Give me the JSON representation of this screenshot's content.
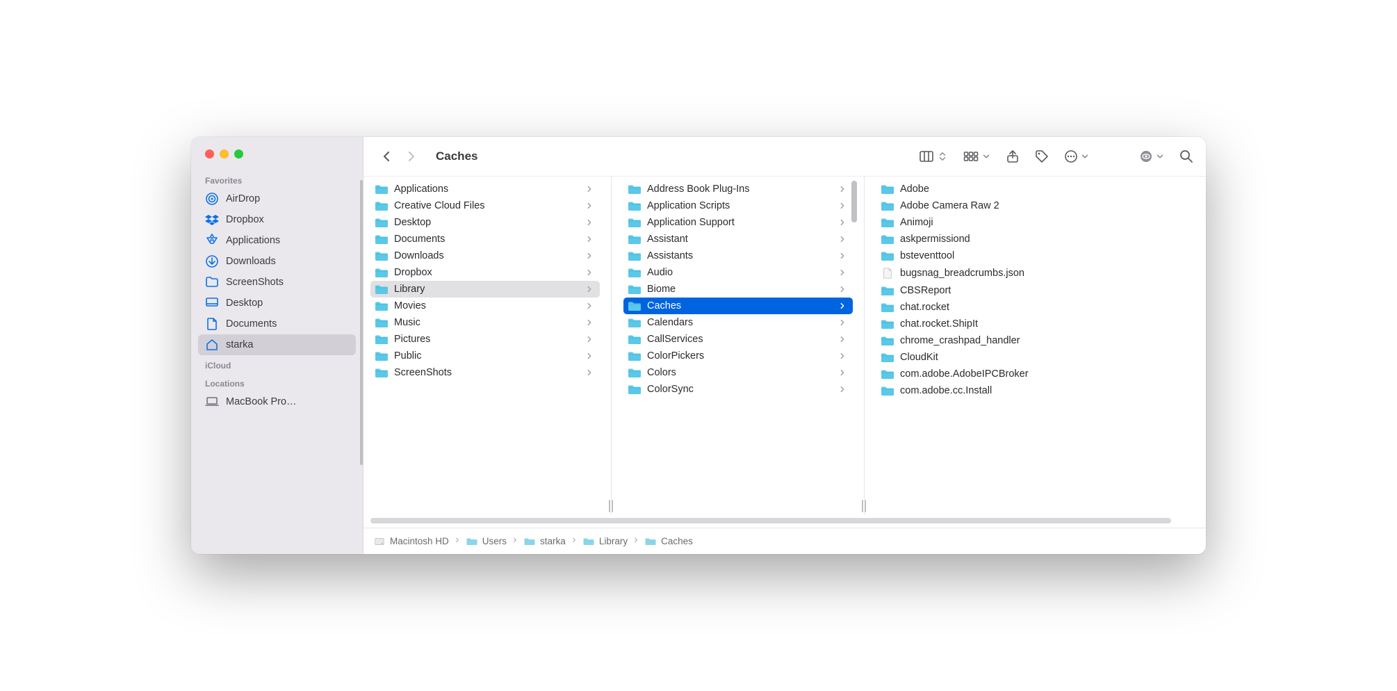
{
  "window": {
    "title": "Caches"
  },
  "sidebar": {
    "sections": [
      {
        "title": "Favorites",
        "items": [
          {
            "icon": "airdrop-icon",
            "label": "AirDrop"
          },
          {
            "icon": "dropbox-icon",
            "label": "Dropbox"
          },
          {
            "icon": "applications-icon",
            "label": "Applications"
          },
          {
            "icon": "downloads-icon",
            "label": "Downloads"
          },
          {
            "icon": "folder-icon",
            "label": "ScreenShots"
          },
          {
            "icon": "desktop-icon",
            "label": "Desktop"
          },
          {
            "icon": "documents-icon",
            "label": "Documents"
          },
          {
            "icon": "home-icon",
            "label": "starka",
            "selected": true
          }
        ]
      },
      {
        "title": "iCloud",
        "items": []
      },
      {
        "title": "Locations",
        "items": [
          {
            "icon": "laptop-icon",
            "label": "MacBook Pro…",
            "grey": true
          }
        ]
      }
    ]
  },
  "columns": [
    {
      "items": [
        {
          "type": "folder",
          "label": "Applications",
          "chevron": true
        },
        {
          "type": "folder",
          "label": "Creative Cloud Files",
          "chevron": true
        },
        {
          "type": "folder",
          "label": "Desktop",
          "chevron": true
        },
        {
          "type": "folder",
          "label": "Documents",
          "chevron": true
        },
        {
          "type": "folder",
          "label": "Downloads",
          "chevron": true
        },
        {
          "type": "folder",
          "label": "Dropbox",
          "chevron": true
        },
        {
          "type": "folder",
          "label": "Library",
          "chevron": true,
          "selected": "muted"
        },
        {
          "type": "folder",
          "label": "Movies",
          "chevron": true
        },
        {
          "type": "folder",
          "label": "Music",
          "chevron": true
        },
        {
          "type": "folder",
          "label": "Pictures",
          "chevron": true
        },
        {
          "type": "folder",
          "label": "Public",
          "chevron": true
        },
        {
          "type": "folder",
          "label": "ScreenShots",
          "chevron": true
        }
      ]
    },
    {
      "scrollIndicator": true,
      "items": [
        {
          "type": "folder",
          "label": "Address Book Plug-Ins",
          "chevron": true
        },
        {
          "type": "folder",
          "label": "Application Scripts",
          "chevron": true
        },
        {
          "type": "folder",
          "label": "Application Support",
          "chevron": true
        },
        {
          "type": "folder",
          "label": "Assistant",
          "chevron": true
        },
        {
          "type": "folder",
          "label": "Assistants",
          "chevron": true
        },
        {
          "type": "folder",
          "label": "Audio",
          "chevron": true
        },
        {
          "type": "folder",
          "label": "Biome",
          "chevron": true
        },
        {
          "type": "folder",
          "label": "Caches",
          "chevron": true,
          "selected": "active"
        },
        {
          "type": "folder",
          "label": "Calendars",
          "chevron": true
        },
        {
          "type": "folder",
          "label": "CallServices",
          "chevron": true
        },
        {
          "type": "folder",
          "label": "ColorPickers",
          "chevron": true
        },
        {
          "type": "folder",
          "label": "Colors",
          "chevron": true
        },
        {
          "type": "folder",
          "label": "ColorSync",
          "chevron": true
        }
      ]
    },
    {
      "items": [
        {
          "type": "folder",
          "label": "Adobe"
        },
        {
          "type": "folder",
          "label": "Adobe Camera Raw 2"
        },
        {
          "type": "folder",
          "label": "Animoji"
        },
        {
          "type": "folder",
          "label": "askpermissiond"
        },
        {
          "type": "folder",
          "label": "bsteventtool"
        },
        {
          "type": "file",
          "label": "bugsnag_breadcrumbs.json"
        },
        {
          "type": "folder",
          "label": "CBSReport"
        },
        {
          "type": "folder",
          "label": "chat.rocket"
        },
        {
          "type": "folder",
          "label": "chat.rocket.ShipIt"
        },
        {
          "type": "folder",
          "label": "chrome_crashpad_handler"
        },
        {
          "type": "folder",
          "label": "CloudKit"
        },
        {
          "type": "folder",
          "label": "com.adobe.AdobeIPCBroker"
        },
        {
          "type": "folder",
          "label": "com.adobe.cc.Install"
        }
      ]
    }
  ],
  "pathbar": [
    {
      "icon": "hd",
      "label": "Macintosh HD"
    },
    {
      "icon": "folder",
      "label": "Users"
    },
    {
      "icon": "folder",
      "label": "starka"
    },
    {
      "icon": "folder",
      "label": "Library"
    },
    {
      "icon": "folder",
      "label": "Caches"
    }
  ]
}
